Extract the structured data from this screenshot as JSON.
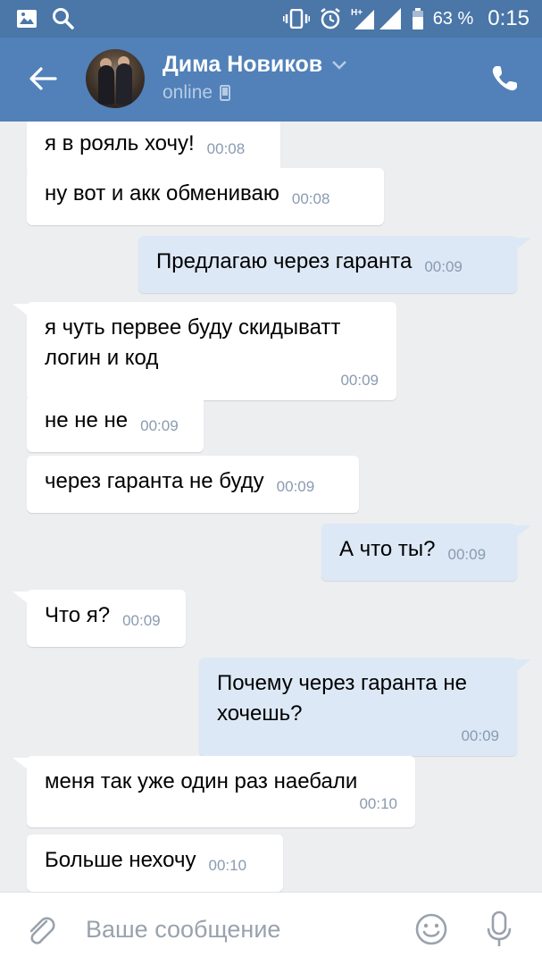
{
  "status_bar": {
    "battery_percent": "63 %",
    "time": "0:15",
    "network": "H+"
  },
  "header": {
    "contact_name": "Дима Новиков",
    "contact_status": "online"
  },
  "messages": [
    {
      "direction": "in",
      "text": "я в рояль хочу!",
      "time": "00:08"
    },
    {
      "direction": "in",
      "text": "ну вот и акк обмениваю",
      "time": "00:08"
    },
    {
      "direction": "out",
      "text": "Предлагаю через гаранта",
      "time": "00:09"
    },
    {
      "direction": "in",
      "text": "я чуть первее буду скидыватт логин и код",
      "time": "00:09"
    },
    {
      "direction": "in",
      "text": "не не не",
      "time": "00:09"
    },
    {
      "direction": "in",
      "text": "через гаранта не буду",
      "time": "00:09"
    },
    {
      "direction": "out",
      "text": "А что ты?",
      "time": "00:09"
    },
    {
      "direction": "in",
      "text": "Что я?",
      "time": "00:09"
    },
    {
      "direction": "out",
      "text": "Почему через гаранта не хочешь?",
      "time": "00:09"
    },
    {
      "direction": "in",
      "text": "меня так уже один раз наебали",
      "time": "00:10"
    },
    {
      "direction": "in",
      "text": "Больше нехочу",
      "time": "00:10"
    }
  ],
  "composer": {
    "placeholder": "Ваше сообщение"
  },
  "colors": {
    "header_bg": "#5181b8",
    "statusbar_bg": "#4a76a8",
    "chat_bg": "#edeef0",
    "incoming_bubble": "#ffffff",
    "outgoing_bubble": "#dce8f5"
  },
  "icons": [
    "image-icon",
    "search-icon",
    "vibrate-icon",
    "alarm-icon",
    "signal-icon",
    "battery-icon",
    "back-arrow-icon",
    "chevron-down-icon",
    "mobile-icon",
    "phone-icon",
    "attach-icon",
    "emoji-icon",
    "mic-icon"
  ]
}
